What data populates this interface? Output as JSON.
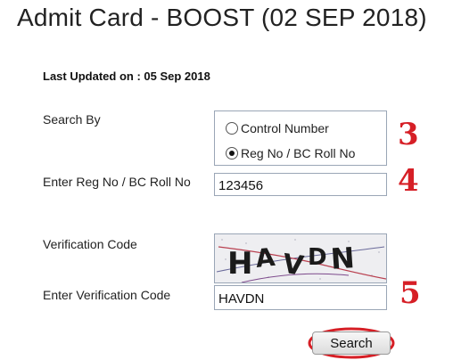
{
  "page": {
    "title": "Admit Card - BOOST (02 SEP 2018)",
    "last_updated": "Last Updated on : 05 Sep 2018"
  },
  "form": {
    "search_by": {
      "label": "Search By",
      "options": [
        {
          "label": "Control Number",
          "checked": false
        },
        {
          "label": "Reg No / BC Roll No",
          "checked": true
        }
      ]
    },
    "reg_no": {
      "label": "Enter Reg No / BC Roll No",
      "value": "123456"
    },
    "verification_code": {
      "label": "Verification Code",
      "captcha_text": "HAVDN"
    },
    "enter_verification_code": {
      "label": "Enter Verification Code",
      "value": "HAVDN"
    },
    "search_button": {
      "label": "Search"
    }
  },
  "annotations": {
    "step_3": "3",
    "step_4": "4",
    "step_5": "5",
    "highlight_color": "#d61f26"
  }
}
